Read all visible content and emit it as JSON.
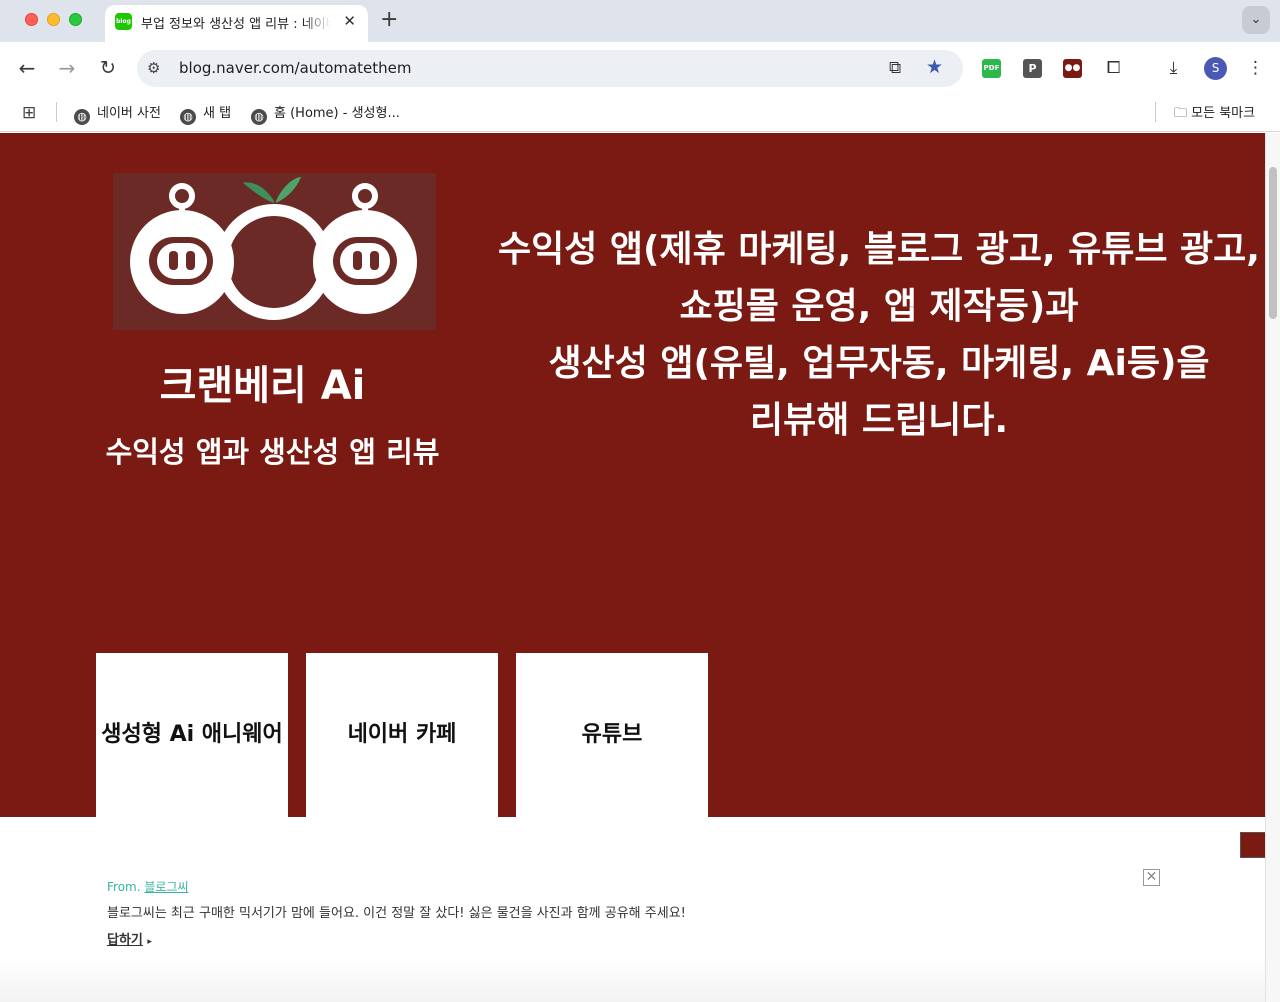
{
  "browser": {
    "tab": {
      "favicon_text": "blog",
      "title": "부업 정보와 생산성 앱 리뷰 : 네이버 블로그",
      "close_glyph": "✕"
    },
    "new_tab_glyph": "+",
    "url": "blog.naver.com/automatethem",
    "extensions": [
      {
        "name": "pdf-extension",
        "label": "PDF"
      },
      {
        "name": "p-extension",
        "label": "P"
      }
    ],
    "profile_initial": "S",
    "colors": {
      "tabstrip": "#dfe3eb",
      "avatar": "#4a59b5"
    }
  },
  "bookmarks": {
    "items": [
      "네이버 사전",
      "새 탭",
      "홈 (Home) - 생성형..."
    ],
    "all_bookmarks": "모든 북마크"
  },
  "page": {
    "hero": {
      "title": "크랜베리 Ai",
      "subtitle": "수익성 앱과 생산성 앱 리뷰",
      "description_lines": [
        "수익성 앱(제휴 마케팅, 블로그 광고, 유튜브 광고,",
        "쇼핑몰 운영, 앱 제작등)과",
        "생산성 앱(유틸, 업무자동, 마케팅, Ai등)을",
        "리뷰해 드립니다."
      ],
      "background": "#7a1a12"
    },
    "cards": [
      "생성형 Ai 애니웨어",
      "네이버 카페",
      "유튜브"
    ],
    "notice": {
      "from_label": "From.",
      "from_source": "블로그씨",
      "message": "블로그씨는 최근 구매한 믹서기가 맘에 들어요. 이건 정말 잘 샀다! 싫은 물건을 사진과 함께 공유해 주세요!",
      "reply_label": "답하기",
      "reply_arrow": "▸",
      "close_glyph": "✕"
    }
  }
}
